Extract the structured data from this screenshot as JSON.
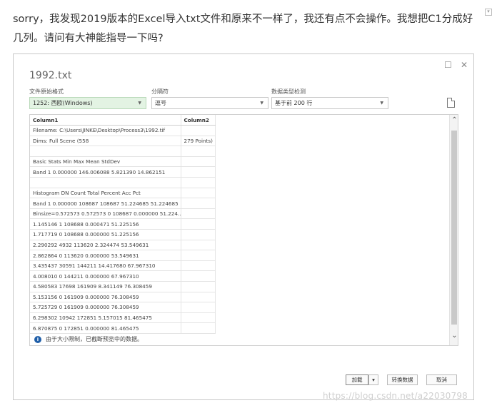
{
  "post": {
    "text": "sorry，我发现2019版本的Excel导入txt文件和原来不一样了，我还有点不会操作。我想把C1分成好几列。请问有大神能指导一下吗?"
  },
  "dialog": {
    "title": "1992.txt",
    "window_controls": {
      "maximize": "☐",
      "close": "✕"
    },
    "origin": {
      "label": "文件原始格式",
      "value": "1252: 西欧(Windows)"
    },
    "delimiter": {
      "label": "分隔符",
      "value": "逗号"
    },
    "detection": {
      "label": "数据类型检测",
      "value": "基于前 200 行"
    },
    "grid": {
      "headers": [
        "Column1",
        "Column2"
      ],
      "rows": [
        [
          "Filename: C:\\Users\\JINKE\\Desktop\\Process3\\1992.tif",
          ""
        ],
        [
          "Dims: Full Scene (558",
          "279 Points)"
        ],
        [
          "",
          ""
        ],
        [
          "Basic Stats Min Max Mean StdDev",
          ""
        ],
        [
          "Band 1 0.000000 146.006088 5.821390 14.862151",
          ""
        ],
        [
          "",
          ""
        ],
        [
          "Histogram DN Count Total Percent Acc Pct",
          ""
        ],
        [
          "Band 1 0.000000 108687 108687 51.224685 51.224685",
          ""
        ],
        [
          "Binsize=0.572573 0.572573 0 108687 0.000000 51.224...",
          ""
        ],
        [
          "1.145146 1 108688 0.000471 51.225156",
          ""
        ],
        [
          "1.717719 0 108688 0.000000 51.225156",
          ""
        ],
        [
          "2.290292 4932 113620 2.324474 53.549631",
          ""
        ],
        [
          "2.862864 0 113620 0.000000 53.549631",
          ""
        ],
        [
          "3.435437 30591 144211 14.417680 67.967310",
          ""
        ],
        [
          "4.008010 0 144211 0.000000 67.967310",
          ""
        ],
        [
          "4.580583 17698 161909 8.341149 76.308459",
          ""
        ],
        [
          "5.153156 0 161909 0.000000 76.308459",
          ""
        ],
        [
          "5.725729 0 161909 0.000000 76.308459",
          ""
        ],
        [
          "6.298302 10942 172851 5.157015 81.465475",
          ""
        ],
        [
          "6.870875 0 172851 0.000000 81.465475",
          ""
        ]
      ]
    },
    "info_message": "由于大小限制，已截断预览中的数据。",
    "buttons": {
      "load": "加载",
      "load_arrow": "▾",
      "transform": "转换数据",
      "cancel": "取消"
    }
  },
  "watermark": "https://blog.csdn.net/a22030798"
}
